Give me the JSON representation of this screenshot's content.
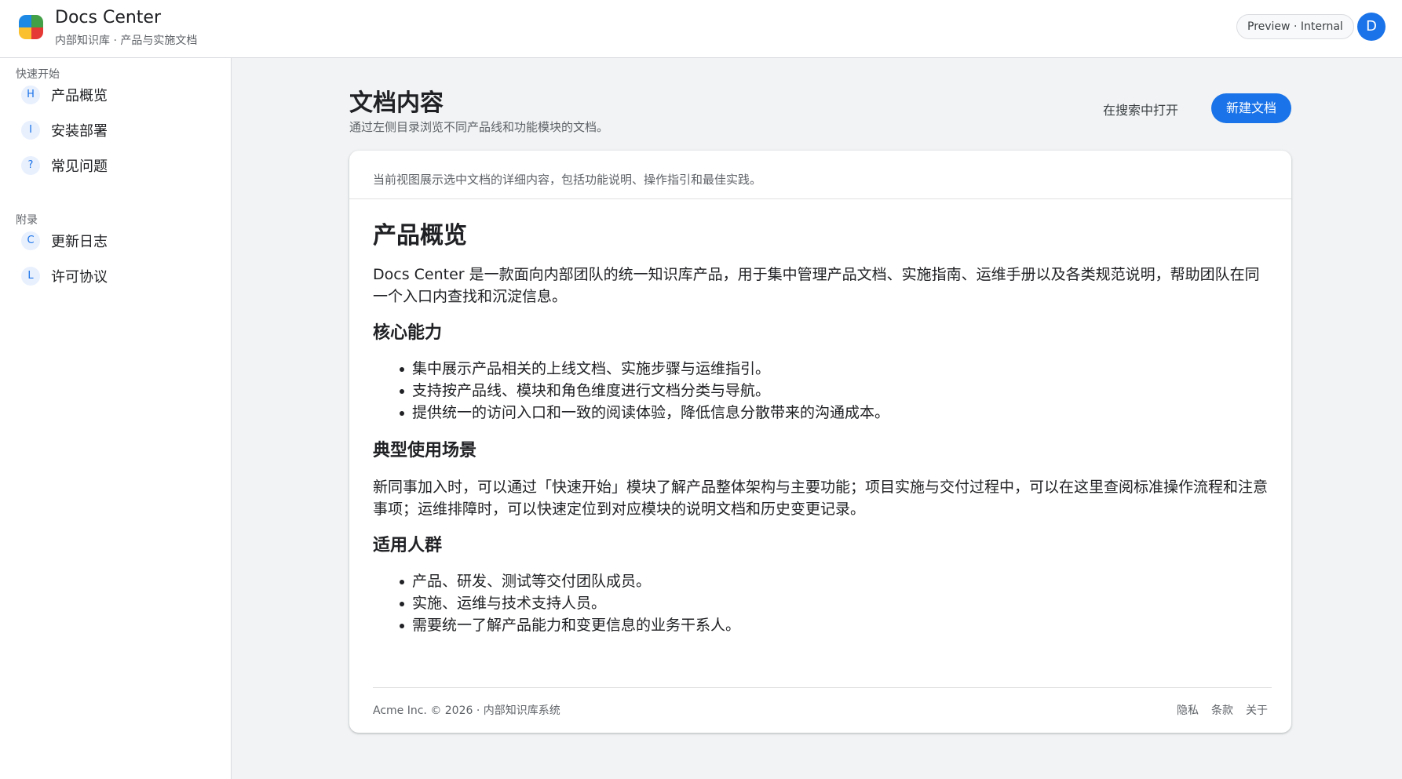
{
  "header": {
    "title": "Docs Center",
    "subtitle": "内部知识库 · 产品与实施文档",
    "environment_label": "Preview · Internal",
    "avatar_initial": "D",
    "logo_colors": [
      "#1e88e5",
      "#43a047",
      "#fbc02d",
      "#e53935"
    ]
  },
  "sidebar": {
    "groups": [
      {
        "title": "快速开始",
        "items": [
          {
            "badge": "H",
            "label": "产品概览"
          },
          {
            "badge": "I",
            "label": "安装部署"
          },
          {
            "badge": "?",
            "label": "常见问题"
          }
        ]
      },
      {
        "title": "附录",
        "items": [
          {
            "badge": "C",
            "label": "更新日志"
          },
          {
            "badge": "L",
            "label": "许可协议"
          }
        ]
      }
    ]
  },
  "page": {
    "title": "文档内容",
    "description": "通过左侧目录浏览不同产品线和功能模块的文档。",
    "open_in_search_label": "在搜索中打开",
    "new_doc_label": "新建文档"
  },
  "card": {
    "note": "当前视图展示选中文档的详细内容，包括功能说明、操作指引和最佳实践。",
    "article": {
      "title": "产品概览",
      "intro": "Docs Center 是一款面向内部团队的统一知识库产品，用于集中管理产品文档、实施指南、运维手册以及各类规范说明，帮助团队在同一个入口内查找和沉淀信息。",
      "sections": [
        {
          "heading": "核心能力",
          "bullets": [
            "集中展示产品相关的上线文档、实施步骤与运维指引。",
            "支持按产品线、模块和角色维度进行文档分类与导航。",
            "提供统一的访问入口和一致的阅读体验，降低信息分散带来的沟通成本。"
          ]
        },
        {
          "heading": "典型使用场景",
          "paragraph": "新同事加入时，可以通过「快速开始」模块了解产品整体架构与主要功能；项目实施与交付过程中，可以在这里查阅标准操作流程和注意事项；运维排障时，可以快速定位到对应模块的说明文档和历史变更记录。"
        },
        {
          "heading": "适用人群",
          "bullets": [
            "产品、研发、测试等交付团队成员。",
            "实施、运维与技术支持人员。",
            "需要统一了解产品能力和变更信息的业务干系人。"
          ]
        }
      ]
    },
    "footer": {
      "copyright": "Acme Inc. © 2026 · 内部知识库系统",
      "links": [
        "隐私",
        "条款",
        "关于"
      ]
    }
  },
  "colors": {
    "accent": "#1a73e8",
    "background": "#f1f3f4"
  }
}
